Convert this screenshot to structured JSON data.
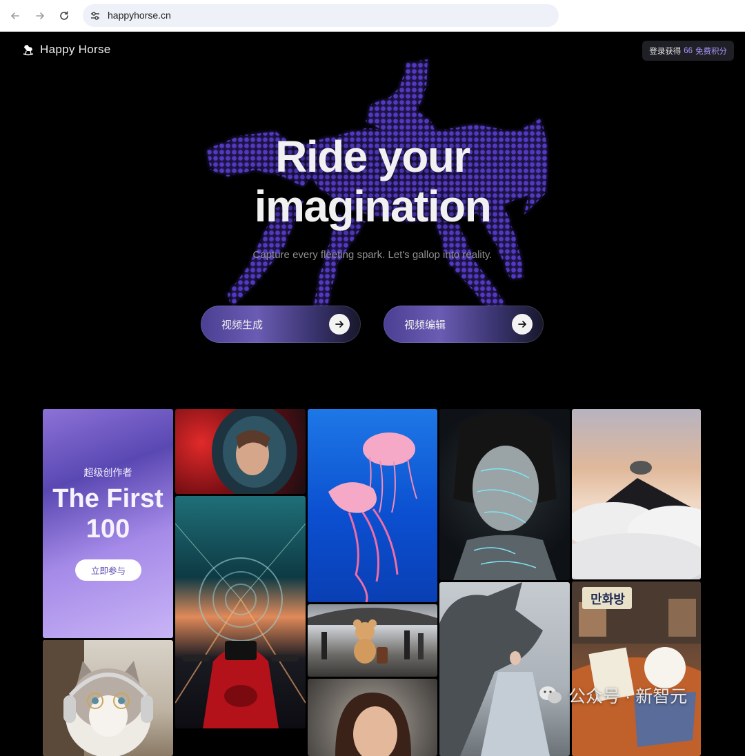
{
  "browser": {
    "url": "happyhorse.cn"
  },
  "header": {
    "brand": "Happy Horse",
    "login_prefix": "登录获得",
    "login_credits": "66",
    "login_suffix": "免费积分"
  },
  "hero": {
    "title_line1": "Ride your",
    "title_line2": "imagination",
    "subtitle": "Capture every fleeting spark. Let's gallop into reality."
  },
  "actions": [
    {
      "label": "视频生成"
    },
    {
      "label": "视频编辑"
    }
  ],
  "promo": {
    "kicker": "超级创作者",
    "headline_line1": "The First",
    "headline_line2": "100",
    "button": "立即参与"
  },
  "gallery": [
    {
      "subject": "astronaut helmet portrait"
    },
    {
      "subject": "jellyfish in blue water"
    },
    {
      "subject": "woman with glowing face writing"
    },
    {
      "subject": "volcano above clouds"
    },
    {
      "subject": "motorcycle in glass tunnel"
    },
    {
      "subject": "teddy bear at train station"
    },
    {
      "subject": "woman with dragon"
    },
    {
      "subject": "puppy reading in bookshop"
    },
    {
      "subject": "cat with headphones"
    },
    {
      "subject": "woman in snow"
    }
  ],
  "bookshop_sign": "만화방",
  "watermark": "公众号 · 新智元",
  "colors": {
    "accent": "#a997ff",
    "horse_dots": "#5b3fd6",
    "page_bg": "#000000"
  }
}
